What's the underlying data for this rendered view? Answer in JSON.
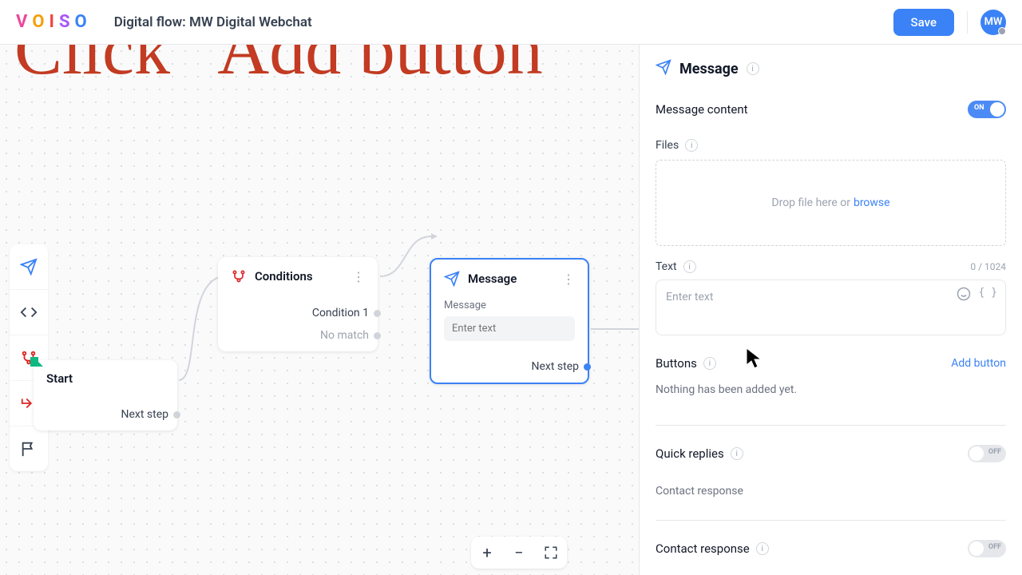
{
  "header": {
    "flow_title": "Digital flow: MW Digital Webchat",
    "save": "Save",
    "avatar": "MW"
  },
  "instruction": "Click \"Add button\"",
  "nodes": {
    "start": {
      "title": "Start",
      "next": "Next step"
    },
    "conditions": {
      "title": "Conditions",
      "cond1": "Condition 1",
      "nomatch": "No match"
    },
    "message": {
      "title": "Message",
      "label": "Message",
      "placeholder": "Enter text",
      "next": "Next step"
    }
  },
  "panel": {
    "title": "Message",
    "message_content": "Message content",
    "toggle_on": "ON",
    "toggle_off": "OFF",
    "files": "Files",
    "drop_text": "Drop file here or",
    "browse": "browse",
    "text_label": "Text",
    "char_count": "0 / 1024",
    "text_placeholder": "Enter text",
    "buttons_label": "Buttons",
    "add_button": "Add button",
    "nothing_added": "Nothing has been added yet.",
    "quick_replies": "Quick replies",
    "contact_response": "Contact response",
    "contact_response2": "Contact response"
  }
}
